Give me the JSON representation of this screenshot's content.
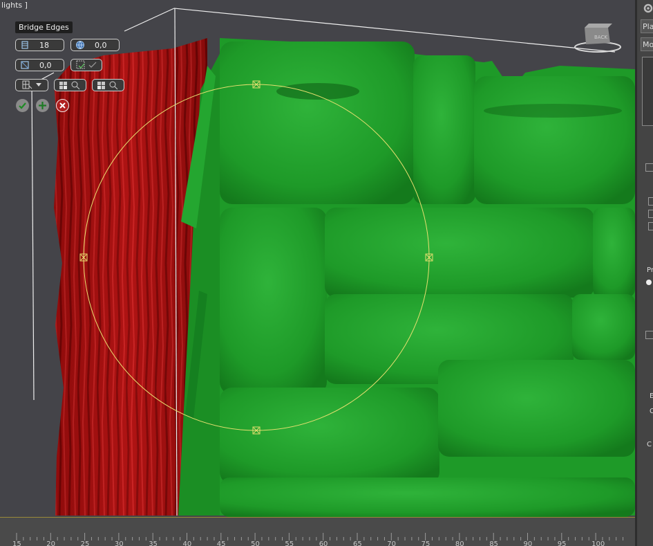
{
  "viewport": {
    "label": "lights ]",
    "caddy": {
      "title": "Bridge Edges",
      "segments_value": "18",
      "taper_value": "0,0",
      "bias_value": "0,0",
      "buttons": [
        "ok-icon",
        "apply-icon",
        "cancel-icon"
      ]
    }
  },
  "command_panel": {
    "field_1": "Pla",
    "field_2": "Mo",
    "letter_pr": "Pr",
    "letter_e": "E",
    "letter_c1": "C",
    "letter_c2": "C"
  },
  "timeline": {
    "ticks": [
      "15",
      "20",
      "25",
      "30",
      "35",
      "40",
      "45",
      "50",
      "55",
      "60",
      "65",
      "70",
      "75",
      "80",
      "85",
      "90",
      "95",
      "100"
    ]
  },
  "colors": {
    "viewport_bg": "#444449",
    "red_object": "#a50f0f",
    "green_object": "#1f9f2a",
    "gizmo": "#e8e070"
  }
}
